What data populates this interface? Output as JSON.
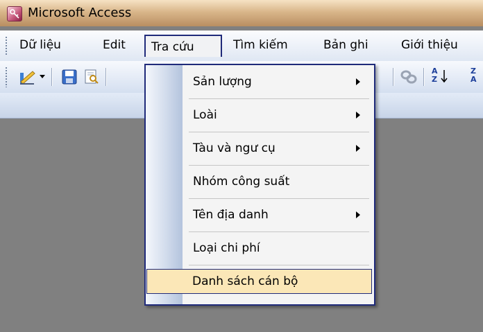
{
  "window": {
    "title": "Microsoft Access"
  },
  "menubar": {
    "items": [
      {
        "label": "Dữ liệu"
      },
      {
        "label": "Edit"
      },
      {
        "label": "Tra cứu"
      },
      {
        "label": "Tìm kiếm"
      },
      {
        "label": "Bản ghi"
      },
      {
        "label": "Giới thiệu"
      }
    ]
  },
  "toolbar": {
    "icons": [
      "design-view-icon",
      "dropdown-arrow-icon",
      "save-icon",
      "print-preview-icon",
      "link-icon",
      "sort-ascending-icon",
      "sort-descending-icon"
    ],
    "sort_glyphs": {
      "az_top": "A",
      "az_bottom": "Z",
      "za_top": "Z",
      "za_bottom": "A"
    }
  },
  "dropdown": {
    "items": [
      {
        "label": "Sản lượng",
        "submenu": true
      },
      {
        "label": "Loài",
        "submenu": true
      },
      {
        "label": "Tàu và ngư cụ",
        "submenu": true
      },
      {
        "label": "Nhóm công suất",
        "submenu": false
      },
      {
        "label": "Tên địa danh",
        "submenu": true
      },
      {
        "label": "Loại chi phí",
        "submenu": false
      },
      {
        "label": "Danh sách cán bộ",
        "submenu": false,
        "highlighted": true
      }
    ]
  },
  "colors": {
    "title_bar": "#d9b68a",
    "highlight": "#fbe7b7",
    "menu_border": "#1f2a7a",
    "workspace": "#808080"
  }
}
